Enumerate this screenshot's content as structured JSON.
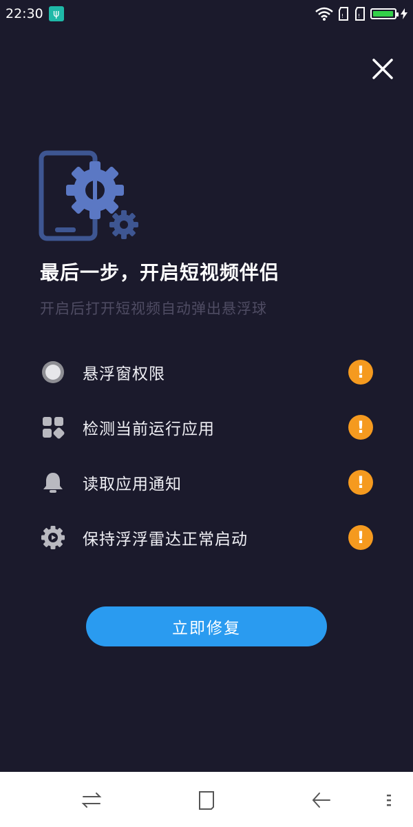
{
  "status_bar": {
    "time": "22:30",
    "usb_icon": "usb-icon",
    "battery_level_percent": 95,
    "battery_color": "#33d04a"
  },
  "dialog": {
    "close_icon": "close-icon",
    "hero_icon": "phone-gear-icon",
    "title": "最后一步，开启短视频伴侣",
    "subtitle": "开启后打开短视频自动弹出悬浮球",
    "permissions": [
      {
        "label": "悬浮窗权限",
        "icon": "float-window-icon",
        "status_icon": "warning-icon"
      },
      {
        "label": "检测当前运行应用",
        "icon": "apps-grid-icon",
        "status_icon": "warning-icon"
      },
      {
        "label": "读取应用通知",
        "icon": "bell-icon",
        "status_icon": "warning-icon"
      },
      {
        "label": "保持浮浮雷达正常启动",
        "icon": "gear-play-icon",
        "status_icon": "warning-icon"
      }
    ],
    "warning_mark": "!",
    "fix_button_label": "立即修复"
  },
  "colors": {
    "background": "#1b1a2c",
    "accent_blue": "#2a9bf0",
    "warning_orange": "#f59a1f",
    "hero_blue": "#5b78c4",
    "subtitle_gray": "#4f4c63"
  },
  "nav_bar": {
    "buttons": [
      "switch-icon",
      "home-square-icon",
      "back-icon",
      "menu-icon"
    ]
  }
}
